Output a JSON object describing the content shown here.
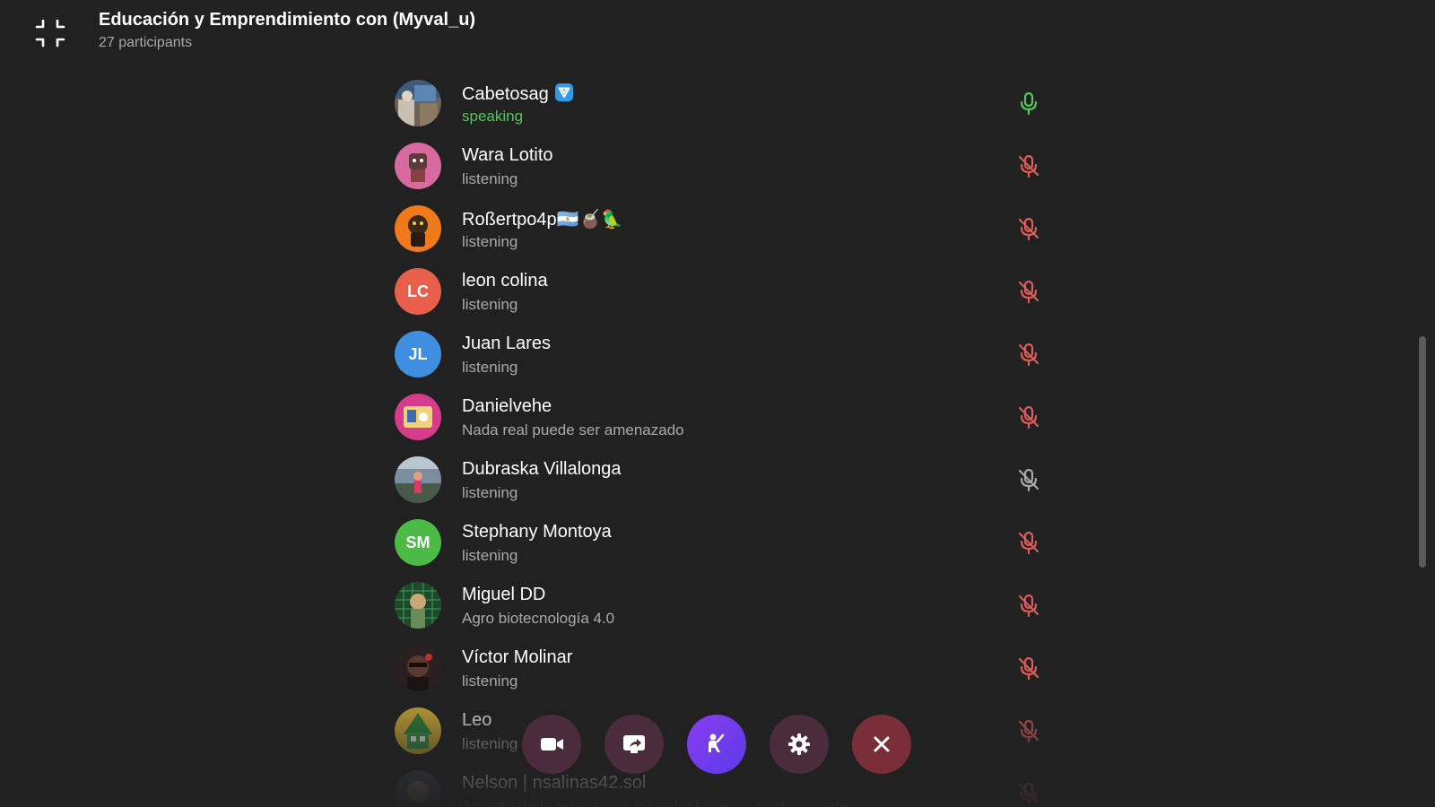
{
  "header": {
    "title": "Educación y Emprendimiento con (Myval_u)",
    "participants": "27 participants"
  },
  "participants": [
    {
      "name": "Cabetosag",
      "status": "speaking",
      "avatar": "photo",
      "mic": "active",
      "verified": true
    },
    {
      "name": "Wara Lotito",
      "status": "listening",
      "avatar": "photo",
      "mic": "muted"
    },
    {
      "name": "Roßertpo4p🇦🇷🧉🦜",
      "status": "listening",
      "avatar": "photo",
      "mic": "muted"
    },
    {
      "name": "leon colina",
      "status": "listening",
      "avatar_initials": "LC",
      "avatar_color": "#e8604c",
      "mic": "muted"
    },
    {
      "name": "Juan Lares",
      "status": "listening",
      "avatar_initials": "JL",
      "avatar_color": "#3e8fe0",
      "mic": "muted"
    },
    {
      "name": "Danielvehe",
      "status": "Nada real puede ser amenazado",
      "avatar": "photo",
      "mic": "muted"
    },
    {
      "name": "Dubraska Villalonga",
      "status": "listening",
      "avatar": "photo",
      "mic": "muted-gray"
    },
    {
      "name": "Stephany Montoya",
      "status": "listening",
      "avatar_initials": "SM",
      "avatar_color": "#4cbb45",
      "mic": "muted"
    },
    {
      "name": "Miguel DD",
      "status": "Agro biotecnología 4.0",
      "avatar": "photo",
      "mic": "muted"
    },
    {
      "name": "Víctor Molinar",
      "status": "listening",
      "avatar": "photo",
      "mic": "muted"
    },
    {
      "name": "Leo",
      "status": "listening",
      "avatar": "photo",
      "mic": "muted"
    },
    {
      "name": "Nelson | nsalinas42.sol",
      "status": "Amante de la tecnología, los videojuegos y criptomonedas",
      "avatar": "photo",
      "mic": "muted"
    }
  ],
  "controls": {
    "video": "video-camera-icon",
    "screen": "screen-share-icon",
    "hand": "raise-hand-icon",
    "settings": "gear-icon",
    "leave": "close-icon"
  },
  "colors": {
    "background": "#212121",
    "speaking": "#4fca5a",
    "muted": "#e05a5a",
    "hand_button": "#7b3cf0",
    "leave_button": "#7a2f38"
  }
}
